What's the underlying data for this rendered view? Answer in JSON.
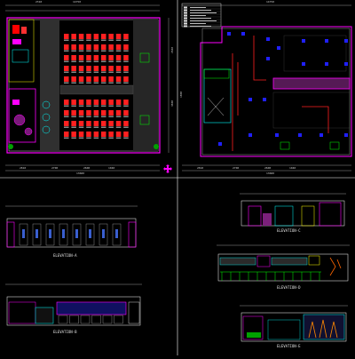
{
  "drawing": {
    "plan_left": {
      "top_dims": [
        "2310",
        "14750",
        "2700",
        "2600",
        "1040"
      ],
      "bottom_dims": [
        "2810",
        "2700",
        "2600",
        "1040"
      ],
      "bottom_total": "13680",
      "side_dims": [
        "1120",
        "2640",
        "3600",
        "5300"
      ]
    },
    "plan_right": {
      "top_dims": [
        "14750"
      ],
      "bottom_dims": [
        "2810",
        "2700",
        "2600",
        "1040"
      ],
      "bottom_total": "13680",
      "side_dims": [
        "1800"
      ]
    },
    "elevations": {
      "a": "ELEVATION-A",
      "b": "ELEVATION-B",
      "c": "ELEVATION-C",
      "d": "ELEVATION-D",
      "e": "ELEVATION-E"
    }
  },
  "colors": {
    "background": "#000000",
    "wall": "#ff00ff",
    "seat": "#ff2020",
    "light": "#2020ff",
    "dimension": "#d0d0d0",
    "frame": "#ffffff",
    "accent_green": "#00c000",
    "accent_yellow": "#ffff00",
    "accent_cyan": "#00ffff"
  },
  "cursor": {
    "icon": "move-cursor-icon"
  }
}
